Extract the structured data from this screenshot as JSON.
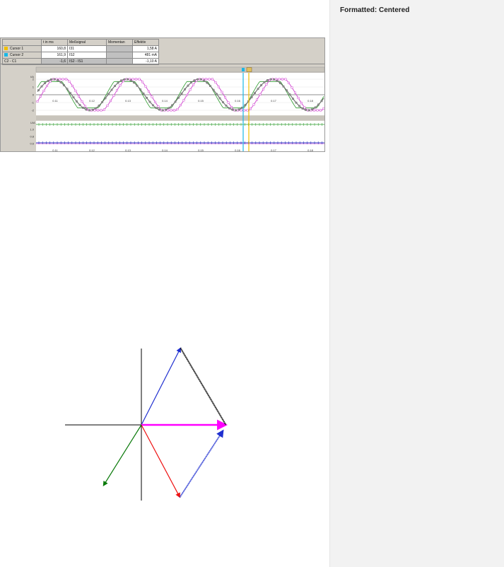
{
  "comment_pane": {
    "label": "Formatted: Centered"
  },
  "cursor_table": {
    "headers": [
      "",
      "t in ms",
      "Meßsignal",
      "Momentan",
      "Effektiv"
    ],
    "rows": [
      {
        "label": "Cursor 1",
        "color": "#f0c000",
        "t": "160,8",
        "signal": "I31",
        "momentan": "",
        "effektiv": "1,58 A"
      },
      {
        "label": "Cursor 2",
        "color": "#19b7e6",
        "t": "161,9",
        "signal": "IS2",
        "momentan": "",
        "effektiv": "481 mA"
      },
      {
        "label": "C2 - C1",
        "color": "",
        "t": "-1,6",
        "signal": "IS2 - IS1",
        "momentan": "",
        "effektiv": "-1,10 A"
      }
    ]
  },
  "upper_plot": {
    "y_unit": "I/A",
    "y_ticks": [
      "2",
      "1",
      "0",
      "-1",
      "-2"
    ],
    "x_ticks": [
      "0.11",
      "0.12",
      "0.13",
      "0.14",
      "0.15",
      "0.16",
      "0.17",
      "0.18"
    ]
  },
  "lower_plot": {
    "y_unit": "U/A",
    "y_ticks": [
      "1.0",
      "0.8",
      "0.6"
    ],
    "x_ticks": [
      "0.11",
      "0.12",
      "0.13",
      "0.14",
      "0.15",
      "0.16",
      "0.17",
      "0.18"
    ]
  },
  "colors": {
    "cursor1": "#f0c000",
    "cursor2": "#19b7e6",
    "trace_grey": "#6e6e6e",
    "trace_magenta": "#d040d0",
    "trace_green": "#2a9a2a",
    "trace_blue": "#3030c0",
    "phasor_blue": "#1f2fd0",
    "phasor_magenta": "#ff00ff",
    "phasor_red": "#ee1111",
    "phasor_green": "#0a7a0a",
    "phasor_sum": "#000000"
  },
  "phasor_diagram": {
    "vectors": [
      {
        "name": "blue",
        "angle_deg": 63,
        "magnitude": 1.0
      },
      {
        "name": "magenta",
        "angle_deg": 0,
        "magnitude": 0.98
      },
      {
        "name": "red",
        "angle_deg": -62,
        "magnitude": 0.95
      },
      {
        "name": "green",
        "angle_deg": -122,
        "magnitude": 0.83
      }
    ]
  }
}
